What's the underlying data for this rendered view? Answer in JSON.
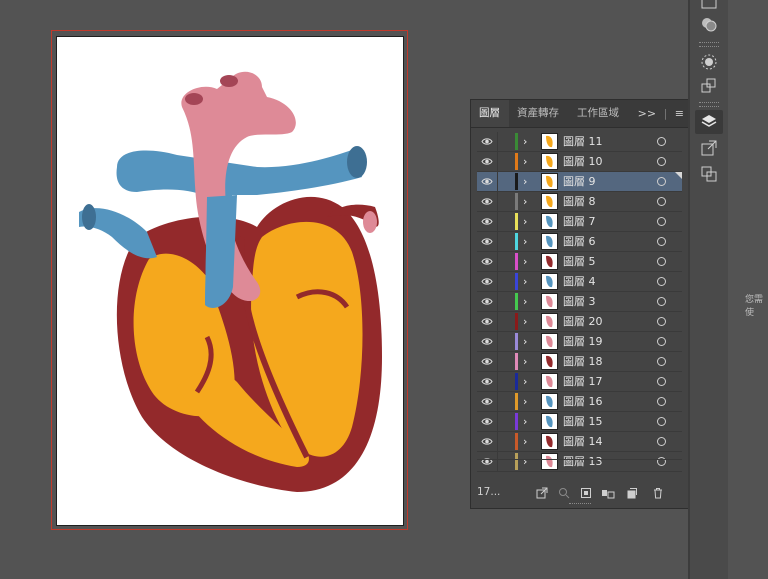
{
  "panel": {
    "tabs": [
      {
        "label": "圖層",
        "active": true
      },
      {
        "label": "資產轉存",
        "active": false
      },
      {
        "label": "工作區域",
        "active": false
      }
    ],
    "menu_glyph": "≡",
    "collapse_glyph": ">>"
  },
  "layers": [
    {
      "name": "圖層 11",
      "color": "#3a8a36",
      "thumb": "orange"
    },
    {
      "name": "圖層 10",
      "color": "#e07a1a",
      "thumb": "orange"
    },
    {
      "name": "圖層 9",
      "color": "#1a1a1a",
      "thumb": "orange",
      "selected": true
    },
    {
      "name": "圖層 8",
      "color": "#7b7b7b",
      "thumb": "orange"
    },
    {
      "name": "圖層 7",
      "color": "#e8e05a",
      "thumb": "blue"
    },
    {
      "name": "圖層 6",
      "color": "#4fd6e0",
      "thumb": "blue"
    },
    {
      "name": "圖層 5",
      "color": "#d84fc8",
      "thumb": "red"
    },
    {
      "name": "圖層 4",
      "color": "#3a45d8",
      "thumb": "blue"
    },
    {
      "name": "圖層 3",
      "color": "#45c84f",
      "thumb": "pink"
    },
    {
      "name": "圖層 20",
      "color": "#8a1a1a",
      "thumb": "pink"
    },
    {
      "name": "圖層 19",
      "color": "#9a8ad8",
      "thumb": "pink"
    },
    {
      "name": "圖層 18",
      "color": "#e08ab8",
      "thumb": "red"
    },
    {
      "name": "圖層 17",
      "color": "#1a2a9a",
      "thumb": "pink"
    },
    {
      "name": "圖層 16",
      "color": "#e09a2a",
      "thumb": "blue"
    },
    {
      "name": "圖層 15",
      "color": "#7a3ad8",
      "thumb": "blue"
    },
    {
      "name": "圖層 14",
      "color": "#c85a2a",
      "thumb": "red"
    },
    {
      "name": "圖層 13",
      "color": "#b8a05a",
      "thumb": "pink"
    }
  ],
  "footer": {
    "layer_count": "17..."
  },
  "right_hint": "您需\n使",
  "colors": {
    "heart_red": "#93292b",
    "heart_yellow": "#f5a81d",
    "vessel_blue": "#5595bf",
    "vessel_blue_dark": "#3e6f93",
    "aorta_pink": "#de8a97",
    "aorta_dark": "#a44556"
  }
}
